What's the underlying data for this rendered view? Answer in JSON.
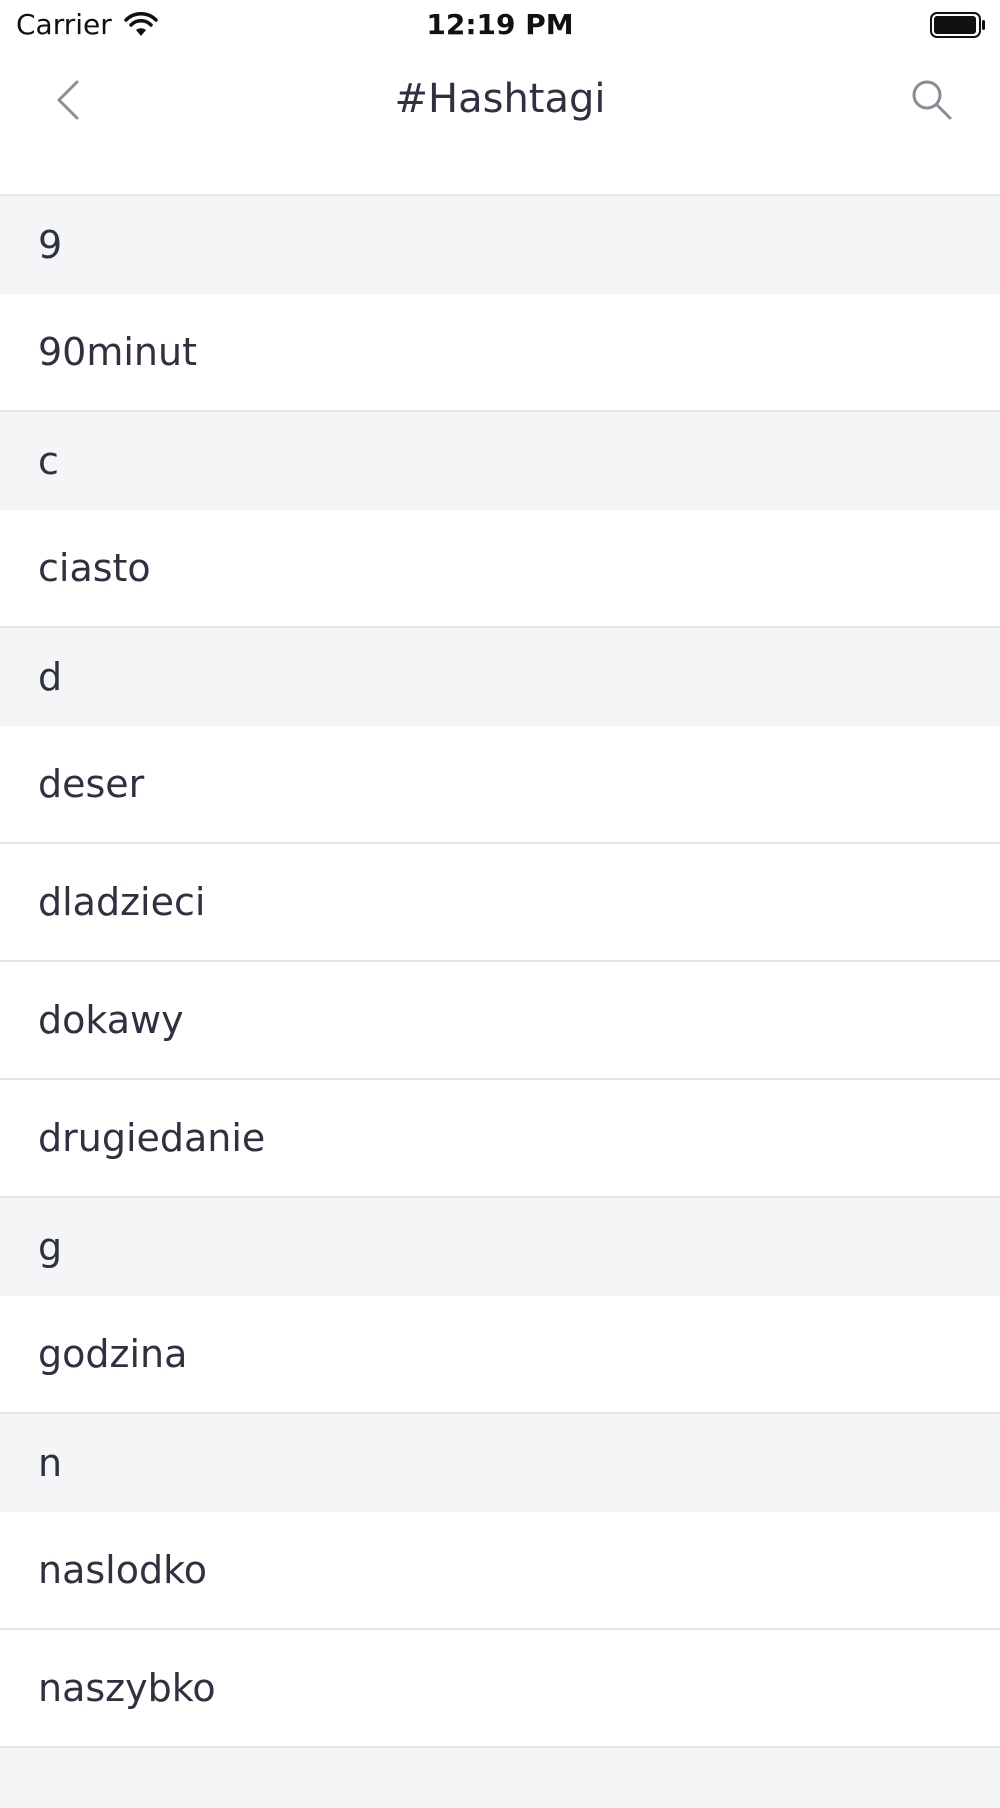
{
  "status_bar": {
    "carrier": "Carrier",
    "time": "12:19 PM"
  },
  "nav": {
    "title": "#Hashtagi",
    "back_icon": "chevron-left-icon",
    "search_icon": "search-icon"
  },
  "colors": {
    "text": "#2f3140",
    "section_bg": "#f4f5f7",
    "divider": "#e3e4e8",
    "icon": "#8a8c96"
  },
  "sections": [
    {
      "header": "9",
      "items": [
        "90minut"
      ]
    },
    {
      "header": "c",
      "items": [
        "ciasto"
      ]
    },
    {
      "header": "d",
      "items": [
        "deser",
        "dladzieci",
        "dokawy",
        "drugiedanie"
      ]
    },
    {
      "header": "g",
      "items": [
        "godzina"
      ]
    },
    {
      "header": "n",
      "items": [
        "naslodko",
        "naszybko"
      ]
    }
  ]
}
